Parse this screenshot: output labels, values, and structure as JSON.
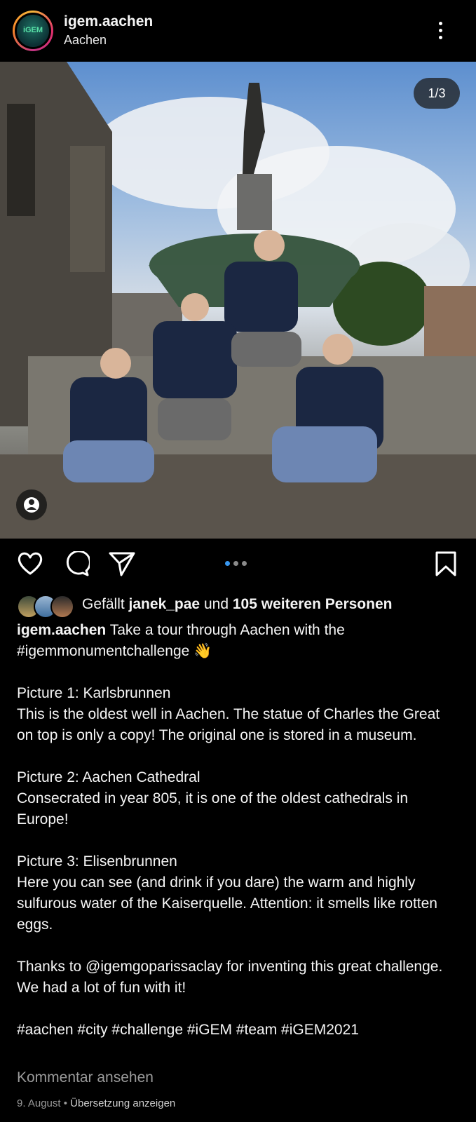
{
  "header": {
    "avatar_text": "iGEM",
    "username": "igem.aachen",
    "location": "Aachen",
    "more_icon": "more-vertical-icon"
  },
  "post": {
    "image_counter": "1/3",
    "tag_icon": "person-tag-icon",
    "photo_description_icon": "photo"
  },
  "actions": {
    "like_icon": "heart-icon",
    "comment_icon": "comment-bubble-icon",
    "share_icon": "send-icon",
    "save_icon": "bookmark-icon",
    "carousel_dots": 3,
    "carousel_active": 1,
    "accent": "#3897f0"
  },
  "likes": {
    "prefix": "Gefällt",
    "user": "janek_pae",
    "middle": "und",
    "count": "105 weiteren Personen"
  },
  "caption": {
    "username": "igem.aachen",
    "line1": "Take a tour through Aachen with the",
    "line1b": "#igemmonumentchallenge 👋",
    "p1_title": "Picture 1: Karlsbrunnen",
    "p1_body": "This is the oldest well in Aachen. The statue of Charles the Great on top is only a copy! The original one is stored in a museum.",
    "p2_title": "Picture 2: Aachen Cathedral",
    "p2_body": "Consecrated in year 805, it is one of the oldest cathedrals in Europe!",
    "p3_title": "Picture 3: Elisenbrunnen",
    "p3_body": "Here you can see (and drink if you dare) the warm and highly sulfurous water of the Kaiserquelle. Attention: it smells like rotten eggs.",
    "thanks": "Thanks to @igemgoparissaclay for inventing this great challenge. We had a lot of fun with it!",
    "hashtags": "#aachen #city #challenge #iGEM #team #iGEM2021"
  },
  "footer": {
    "view_comments": "Kommentar ansehen",
    "date": "9. August",
    "separator": " • ",
    "translate": "Übersetzung anzeigen"
  }
}
